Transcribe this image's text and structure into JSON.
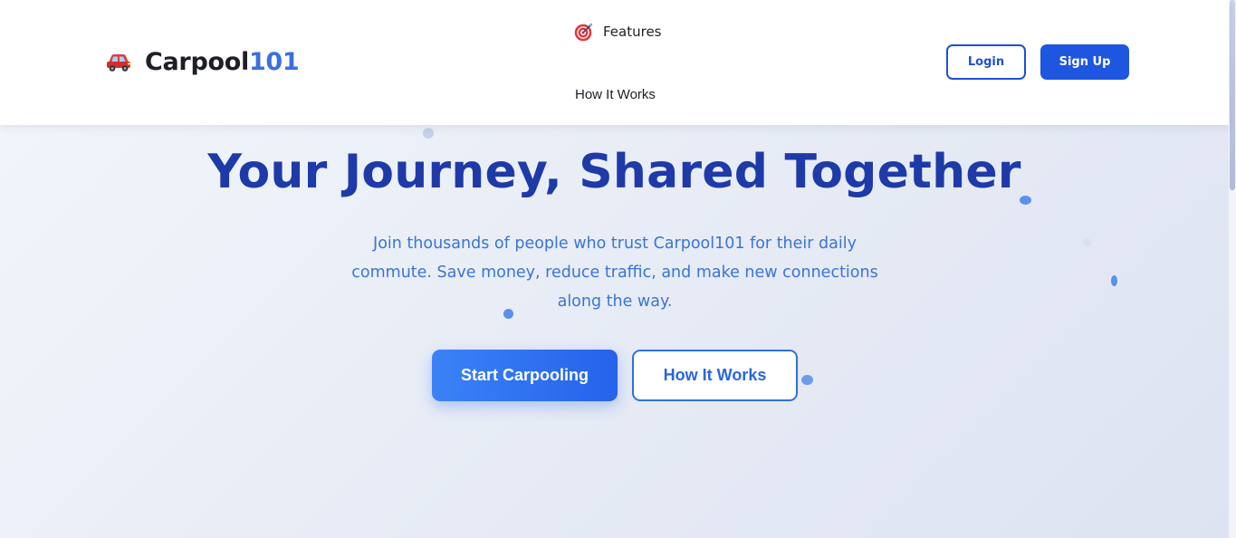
{
  "brand": {
    "name": "Carpool",
    "accent": "101",
    "icon": "car-icon"
  },
  "nav": {
    "features": {
      "label": "Features",
      "icon": "target-icon"
    },
    "how_it_works": "How It Works"
  },
  "auth": {
    "login": "Login",
    "signup": "Sign Up"
  },
  "hero": {
    "title": "Your Journey, Shared Together",
    "subtitle": "Join thousands of people who trust Carpool101 for their daily commute. Save money, reduce traffic, and make new connections along the way.",
    "primary_cta": "Start Carpooling",
    "secondary_cta": "How It Works"
  },
  "colors": {
    "brand_blue": "#1e56e0",
    "title_blue": "#1e3aa8",
    "accent_blue": "#3b6fe0",
    "text_dark": "#1c1f26"
  }
}
